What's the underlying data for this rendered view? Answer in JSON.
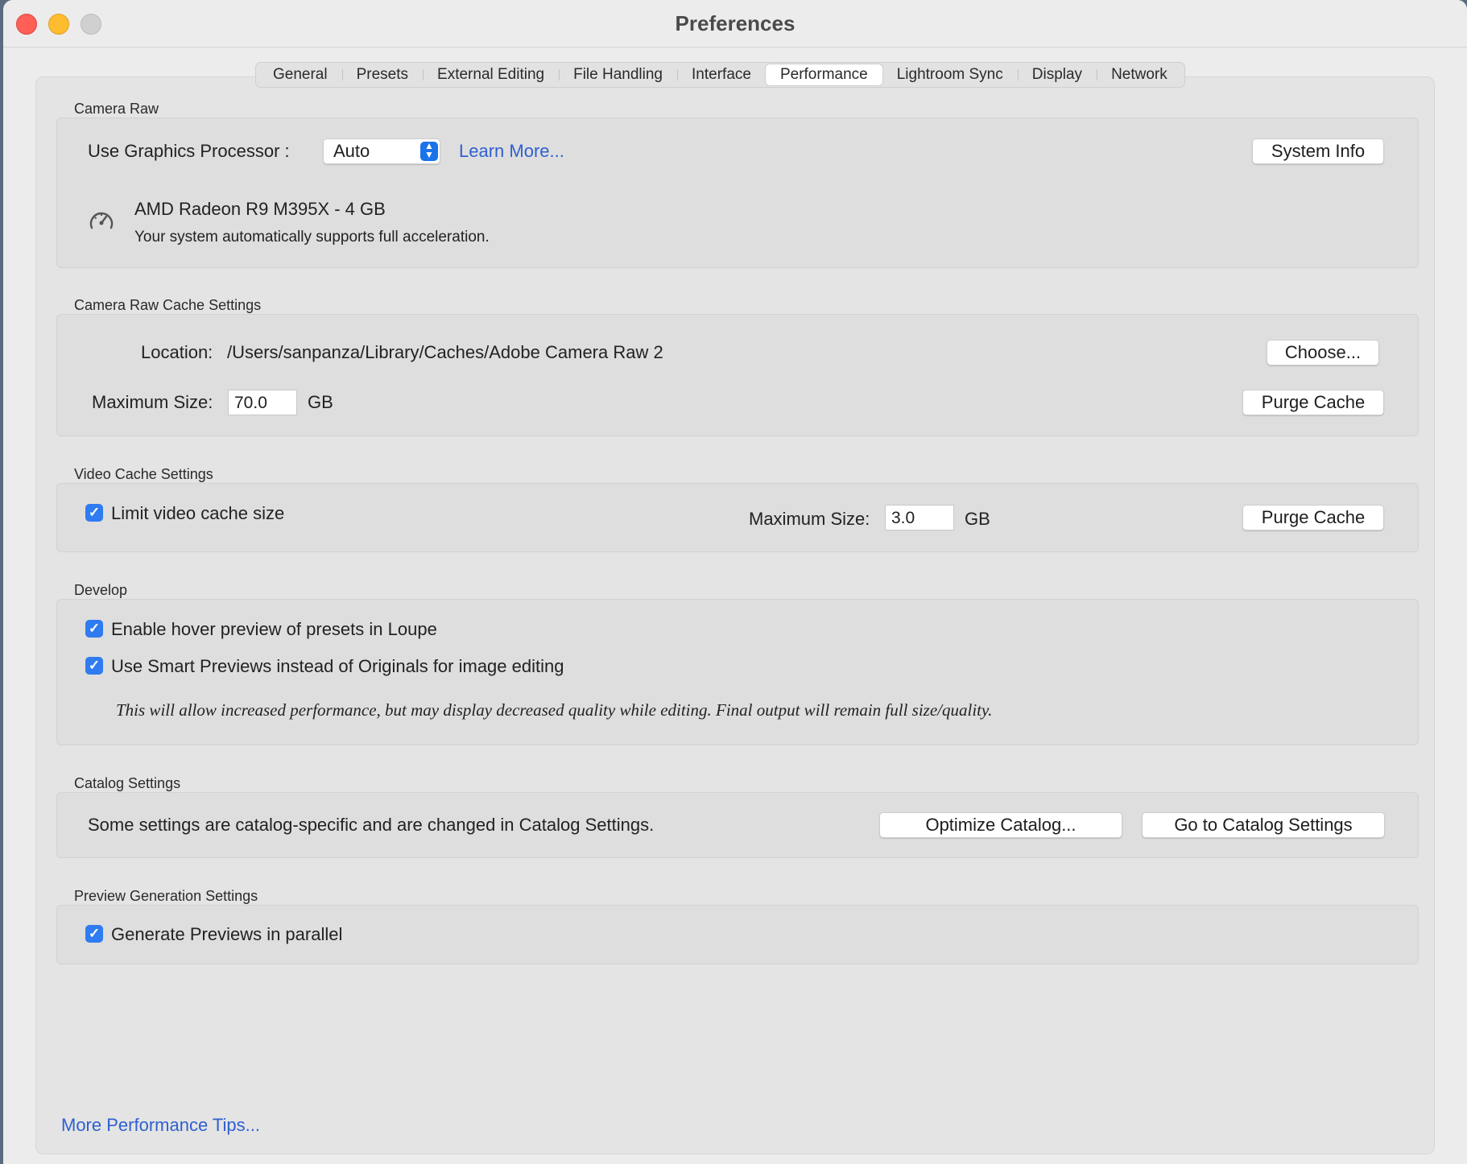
{
  "window": {
    "title": "Preferences"
  },
  "tabs": [
    {
      "label": "General"
    },
    {
      "label": "Presets"
    },
    {
      "label": "External Editing"
    },
    {
      "label": "File Handling"
    },
    {
      "label": "Interface"
    },
    {
      "label": "Performance"
    },
    {
      "label": "Lightroom Sync"
    },
    {
      "label": "Display"
    },
    {
      "label": "Network"
    }
  ],
  "active_tab": "Performance",
  "camera_raw": {
    "section_title": "Camera Raw",
    "gpu_label": "Use Graphics Processor :",
    "gpu_value": "Auto",
    "learn_more": "Learn More...",
    "system_info": "System Info",
    "gpu_name": "AMD Radeon R9 M395X - 4 GB",
    "gpu_status": "Your system automatically supports full acceleration."
  },
  "raw_cache": {
    "section_title": "Camera Raw Cache Settings",
    "location_label": "Location:",
    "location_value": "/Users/sanpanza/Library/Caches/Adobe Camera Raw 2",
    "choose": "Choose...",
    "max_size_label": "Maximum Size:",
    "max_size_value": "70.0",
    "unit": "GB",
    "purge": "Purge Cache"
  },
  "video_cache": {
    "section_title": "Video Cache Settings",
    "limit_label": "Limit video cache size",
    "limit_checked": true,
    "max_size_label": "Maximum Size:",
    "max_size_value": "3.0",
    "unit": "GB",
    "purge": "Purge Cache"
  },
  "develop": {
    "section_title": "Develop",
    "hover_label": "Enable hover preview of presets in Loupe",
    "hover_checked": true,
    "smart_label": "Use Smart Previews instead of Originals for image editing",
    "smart_checked": true,
    "note": "This will allow increased performance, but may display decreased quality while editing. Final output will remain full size/quality."
  },
  "catalog": {
    "section_title": "Catalog Settings",
    "text": "Some settings are catalog-specific and are changed in Catalog Settings.",
    "optimize": "Optimize Catalog...",
    "goto": "Go to Catalog Settings"
  },
  "preview": {
    "section_title": "Preview Generation Settings",
    "parallel_label": "Generate Previews in parallel",
    "parallel_checked": true
  },
  "footer": {
    "tips_link": "More Performance Tips..."
  },
  "colors": {
    "accent": "#2f7bf0",
    "link": "#2f5fd0"
  }
}
